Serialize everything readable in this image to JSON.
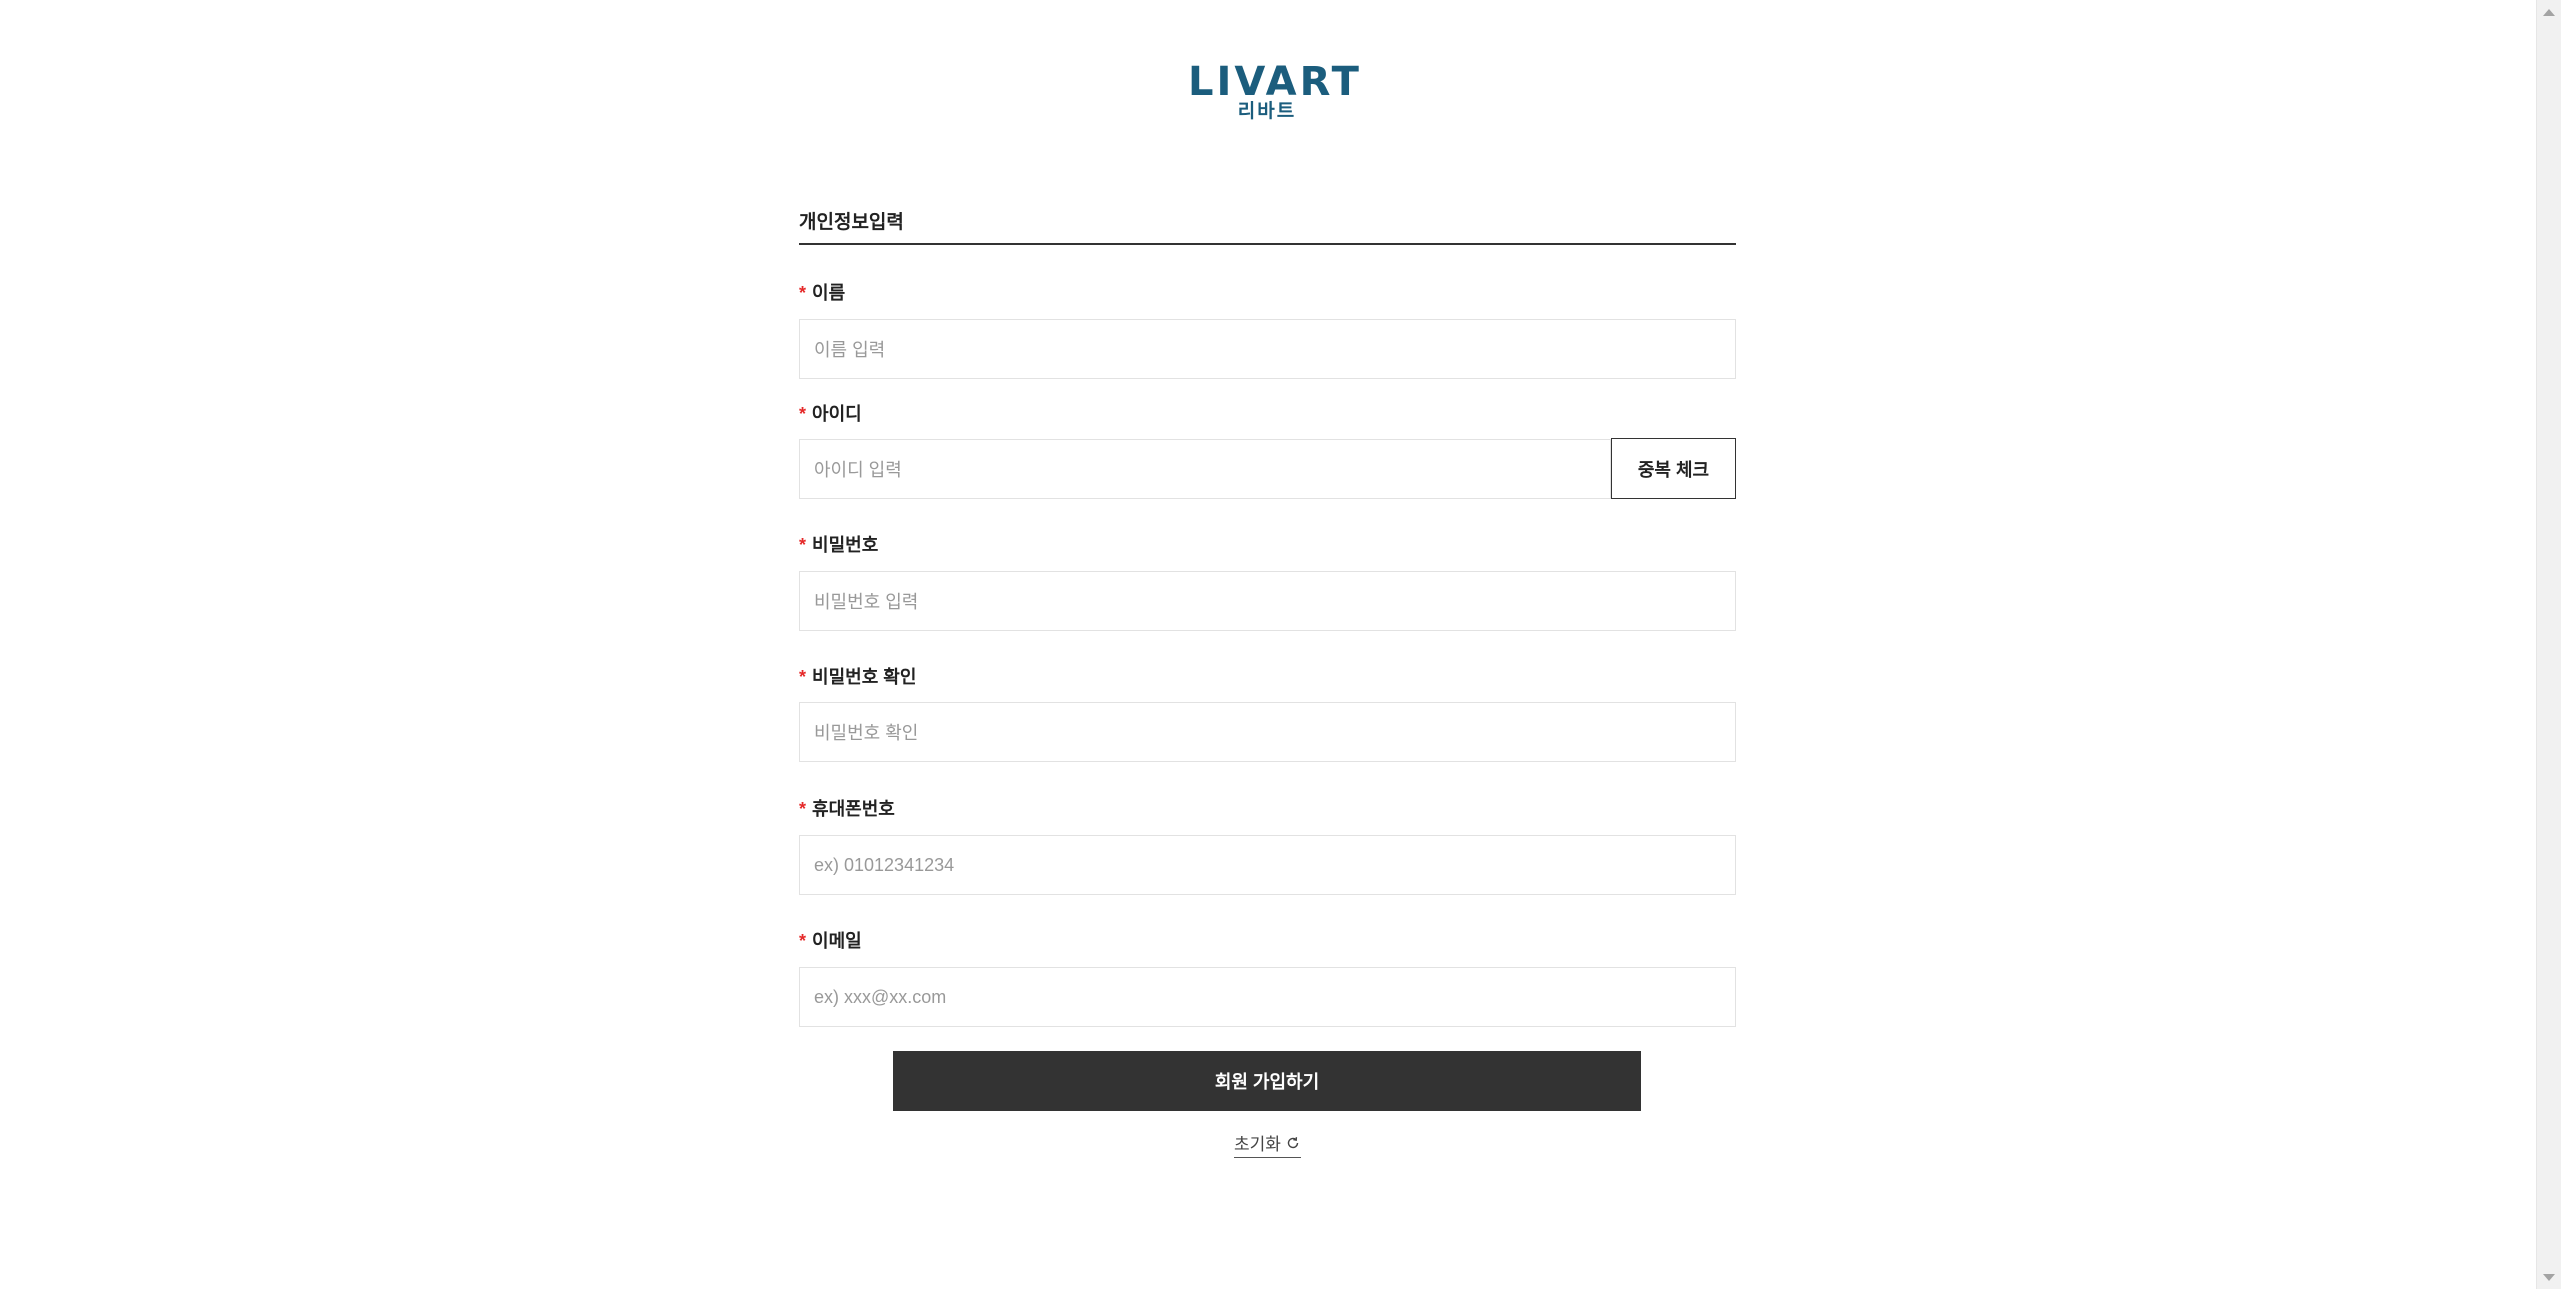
{
  "brand": {
    "logo_en": "LIVART",
    "logo_kr": "리바트",
    "color": "#1b5d7d"
  },
  "form": {
    "section_title": "개인정보입력",
    "required_mark": "*",
    "fields": {
      "name": {
        "label": "이름",
        "placeholder": "이름 입력"
      },
      "userid": {
        "label": "아이디",
        "placeholder": "아이디 입력",
        "button": "중복 체크"
      },
      "password": {
        "label": "비밀번호",
        "placeholder": "비밀번호 입력"
      },
      "password_confirm": {
        "label": "비밀번호 확인",
        "placeholder": "비밀번호 확인"
      },
      "phone": {
        "label": "휴대폰번호",
        "placeholder": "ex) 01012341234"
      },
      "email": {
        "label": "이메일",
        "placeholder": "ex) xxx@xx.com"
      }
    },
    "submit_label": "회원 가입하기",
    "reset_label": "초기화"
  },
  "colors": {
    "required": "#e52929",
    "submit_bg": "#333333"
  },
  "icons": {
    "reset": "refresh-icon",
    "scroll_up": "scroll-up-arrow-icon",
    "scroll_down": "scroll-down-arrow-icon"
  }
}
